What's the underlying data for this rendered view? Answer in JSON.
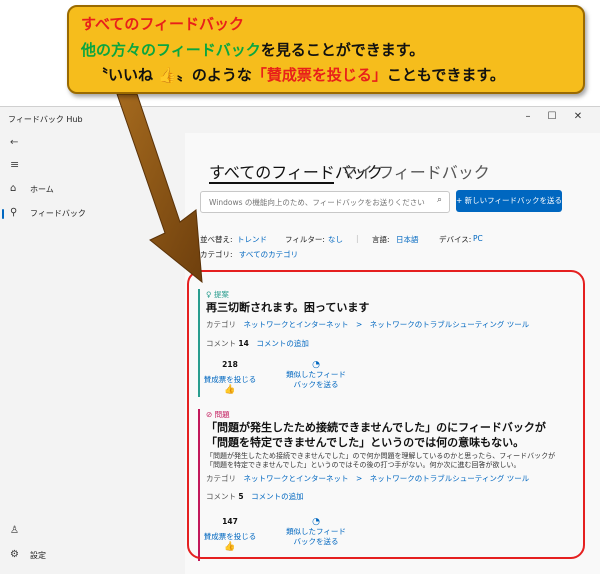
{
  "window": {
    "title": "フィードバック Hub",
    "minimize": "–",
    "maximize": "☐",
    "close": "✕"
  },
  "sidebar": {
    "back": "←",
    "menu": "≡",
    "items": [
      {
        "label": "ホーム",
        "icon": "home-icon",
        "glyph": "⌂"
      },
      {
        "label": "フィードバック",
        "icon": "feedback-icon",
        "glyph": "⚲"
      }
    ],
    "bottom": [
      {
        "label": "",
        "icon": "person-icon",
        "glyph": "♙"
      },
      {
        "label": "設定",
        "icon": "gear-icon",
        "glyph": "⚙"
      }
    ]
  },
  "main": {
    "tabs": [
      {
        "label": "すべてのフィードバック"
      },
      {
        "label": "マイ フィードバック"
      }
    ],
    "search": {
      "placeholder": "Windows の機能向上のため、フィードバックをお送りください",
      "icon": "search-icon"
    },
    "new_button": "+ 新しいフィードバックを送る",
    "filters": {
      "sort_label": "並べ替え:",
      "sort_value": "トレンド",
      "filter_label": "フィルター:",
      "filter_value": "なし",
      "lang_label": "言語:",
      "lang_value": "日本語",
      "device_label": "デバイス:",
      "device_value": "PC",
      "category_label": "カテゴリ:",
      "category_value": "すべてのカテゴリ"
    }
  },
  "cards": [
    {
      "type": "提案",
      "title": "再三切断されます。困っています",
      "category_label": "カテゴリ",
      "category_path": "ネットワークとインターネット　>　ネットワークのトラブルシューティング ツール",
      "comment_label": "コメント",
      "comment_count": "14",
      "add_comment": "コメントの追加",
      "votes": "218",
      "vote_label": "賛成票を投じる",
      "similar_label_1": "類似したフィード",
      "similar_label_2": "バックを送る"
    },
    {
      "type": "問題",
      "title": "「問題が発生したため接続できませんでした」のにフィードバックが「問題を特定できませんでした」というのでは何の意味もない。",
      "description": "「問題が発生したため接続できませんでした」ので何か問題を理解しているのかと思ったら、フィードバックが「問題を特定できませんでした」というのではその後の打つ手がない。何か次に進む回答が欲しい。",
      "category_label": "カテゴリ",
      "category_path": "ネットワークとインターネット　>　ネットワークのトラブルシューティング ツール",
      "comment_label": "コメント",
      "comment_count": "5",
      "add_comment": "コメントの追加",
      "votes": "147",
      "vote_label": "賛成票を投じる",
      "similar_label_1": "類似したフィード",
      "similar_label_2": "バックを送る"
    }
  ],
  "callout": {
    "line1": "すべてのフィードバック",
    "line2_green": "他の方々のフィードバック",
    "line2_rest": "を見ることができます。",
    "line3_a": "〝いいね 👍〟のような",
    "line3_red": "「賛成票を投じる」",
    "line3_b": "こともできます。"
  },
  "colors": {
    "accent": "#0067c0",
    "callout_bg": "#f6bd1c",
    "highlight_red": "#e52020",
    "suggestion_stripe": "#2a9d8f",
    "issue_stripe": "#c2185b"
  }
}
